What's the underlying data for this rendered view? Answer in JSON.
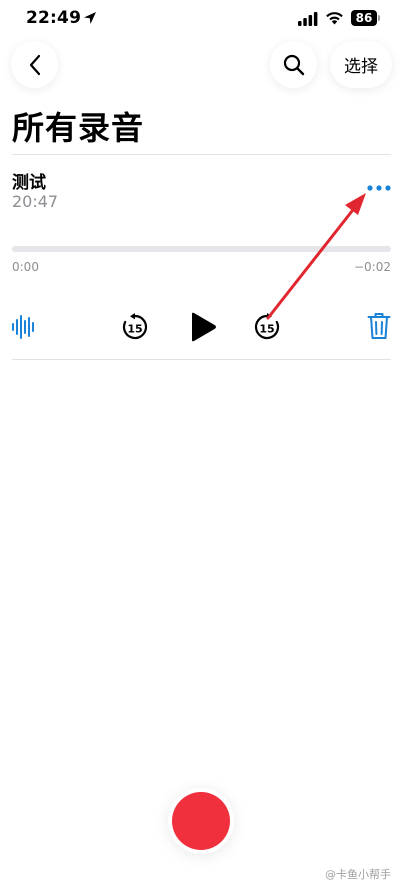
{
  "status_bar": {
    "time": "22:49",
    "battery": "86",
    "icons": [
      "location-arrow-icon",
      "cellular-signal-icon",
      "wifi-icon",
      "battery-icon"
    ]
  },
  "nav": {
    "back_icon": "chevron-left-icon",
    "search_icon": "search-icon",
    "select_label": "选择"
  },
  "page": {
    "title": "所有录音"
  },
  "recording": {
    "name": "测试",
    "duration": "20:47",
    "more_icon": "ellipsis-icon",
    "progress": 0.0,
    "time_elapsed": "0:00",
    "time_remaining": "−0:02"
  },
  "controls": {
    "waveform_icon": "waveform-icon",
    "skip_back_label": "15",
    "play_icon": "play-icon",
    "skip_forward_label": "15",
    "delete_icon": "trash-icon"
  },
  "colors": {
    "accent": "#1a82d9",
    "record": "#f0303d",
    "annotation_arrow": "#e0262e",
    "secondary_text": "#8e8e93"
  },
  "watermark": {
    "text": "@卡鱼小帮手"
  }
}
